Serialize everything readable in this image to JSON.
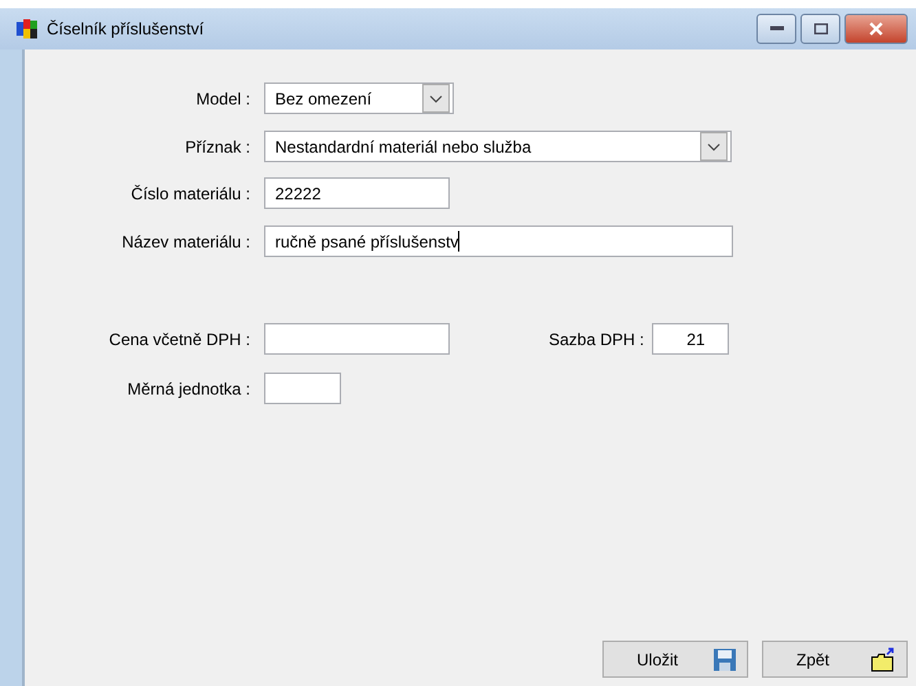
{
  "window": {
    "title": "Číselník příslušenství"
  },
  "fields": [
    {
      "kind": "select",
      "label": "Model :",
      "value": "Bez omezení"
    },
    {
      "kind": "select",
      "label": "Příznak :",
      "value": "Nestandardní materiál nebo služba"
    },
    {
      "kind": "text",
      "label": "Číslo materiálu :",
      "value": "22222"
    },
    {
      "kind": "text",
      "label": "Název materiálu :",
      "value": "ručně psané příslušenstv",
      "focused": true
    }
  ],
  "price": {
    "label": "Cena včetně DPH :"
  },
  "vat": {
    "label": "Sazba DPH :",
    "value": "21"
  },
  "unit": {
    "label": "Měrná jednotka :"
  },
  "buttons": [
    {
      "kind": "save",
      "label": "Uložit"
    },
    {
      "kind": "back",
      "label": "Zpět"
    }
  ]
}
